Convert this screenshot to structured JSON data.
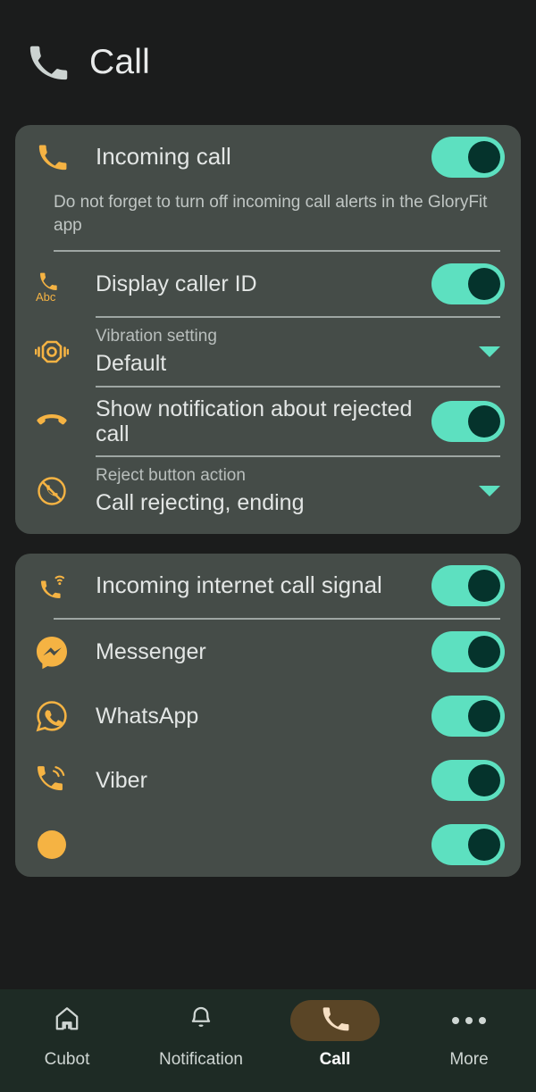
{
  "header": {
    "title": "Call",
    "icon": "phone-icon"
  },
  "colors": {
    "page_background": "#1b1c1c",
    "card_background": "#454c48",
    "accent_orange": "#f5b343",
    "toggle_on_track": "#5de0c0",
    "toggle_on_knob": "#05332c",
    "nav_active_pill": "#5a4526",
    "nav_background": "#1e2b25"
  },
  "card_call": {
    "incoming_call": {
      "label": "Incoming call",
      "icon": "phone-icon",
      "toggle": "on"
    },
    "caption": "Do not forget to turn off incoming call alerts in the GloryFit app",
    "display_caller_id": {
      "label": "Display caller ID",
      "icon": "phone-abc-icon",
      "icon_sublabel": "Abc",
      "toggle": "on"
    },
    "vibration_setting": {
      "label": "Vibration setting",
      "value": "Default",
      "icon": "vibration-watch-icon",
      "control": "dropdown"
    },
    "rejected_call_notification": {
      "label": "Show notification about rejected call",
      "icon": "call-end-icon",
      "toggle": "on"
    },
    "reject_button_action": {
      "label": "Reject button action",
      "value": "Call rejecting, ending",
      "icon": "call-reject-circle-icon",
      "control": "dropdown"
    }
  },
  "card_internet": {
    "header": {
      "label": "Incoming internet call signal",
      "icon": "phone-wifi-icon",
      "toggle": "on"
    },
    "apps": [
      {
        "label": "Messenger",
        "icon": "messenger-icon",
        "toggle": "on"
      },
      {
        "label": "WhatsApp",
        "icon": "whatsapp-icon",
        "toggle": "on"
      },
      {
        "label": "Viber",
        "icon": "viber-icon",
        "toggle": "on"
      }
    ]
  },
  "bottom_nav": {
    "items": [
      {
        "label": "Cubot",
        "icon": "home-icon",
        "active": false
      },
      {
        "label": "Notification",
        "icon": "bell-icon",
        "active": false
      },
      {
        "label": "Call",
        "icon": "phone-icon",
        "active": true
      },
      {
        "label": "More",
        "icon": "more-dots-icon",
        "active": false
      }
    ]
  }
}
